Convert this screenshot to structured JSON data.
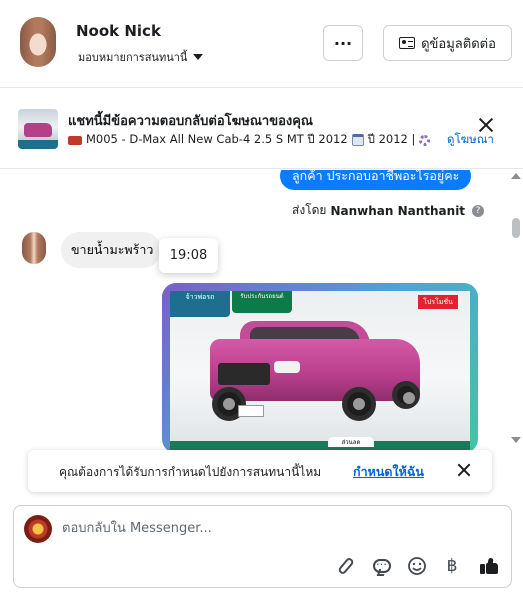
{
  "header": {
    "contact_name": "Nook Nick",
    "assign_label": "มอบหมายการสนทนานี้",
    "more_label": "···",
    "contact_info_label": "ดูข้อมูลติดต่อ"
  },
  "ad_context": {
    "title": "แชทนี้มีข้อความตอบกลับต่อโฆษณาของคุณ",
    "subtitle_part1": "M005 - D-Max All New Cab-4 2.5 S MT ปี 2012",
    "subtitle_part2": "ปี 2012 |",
    "view_ad_label": "ดูโฆษณา"
  },
  "messages": {
    "outgoing_text": "ลูกค้า ประกอบอาชีพอะไรอยู่คะ",
    "sent_by_prefix": "ส่งโดย",
    "sent_by_name": "Nanwhan Nanthanit",
    "help_glyph": "?",
    "incoming_text": "ขายน้ำมะพร้าว",
    "tooltip_time": "19:08"
  },
  "photo_ad": {
    "logo_text": "จ้าวพ่อรถ",
    "badge_text": "รับประกันรถยนต์",
    "promo_text": "โปรโมชั่น",
    "tag_text": "ส่วนลด"
  },
  "assign_banner": {
    "question": "คุณต้องการได้รับการกำหนดไปยังการสนทนานี้ไหม",
    "action_label": "กำหนดให้ฉัน"
  },
  "composer": {
    "placeholder": "ตอบกลับใน Messenger...",
    "value": "",
    "baht_glyph": "฿"
  },
  "colors": {
    "accent": "#0a7cff",
    "link": "#0064d1",
    "text": "#1c1e21"
  }
}
